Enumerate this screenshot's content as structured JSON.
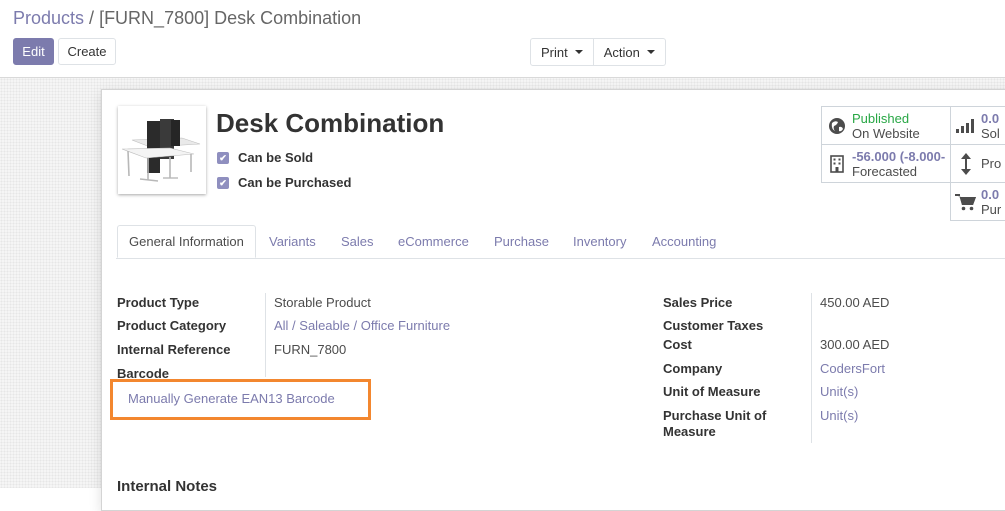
{
  "breadcrumb": {
    "parent": "Products",
    "separator": "/",
    "current": "[FURN_7800] Desk Combination"
  },
  "toolbar": {
    "edit_label": "Edit",
    "create_label": "Create",
    "print_label": "Print",
    "action_label": "Action"
  },
  "product": {
    "name": "Desk Combination",
    "can_be_sold_label": "Can be Sold",
    "can_be_purchased_label": "Can be Purchased",
    "image_icon": "desk-combination-image"
  },
  "smart_buttons": {
    "published": {
      "value": "Published",
      "label": "On Website",
      "icon": "globe-icon",
      "color": "#28a745"
    },
    "forecast": {
      "value": "-56.000 (-8.000-",
      "label": "Forecasted",
      "icon": "building-icon"
    },
    "sold": {
      "value": "0.0",
      "label": "Sol",
      "icon": "signal-icon"
    },
    "product_moves": {
      "label": "Pro",
      "icon": "arrows-v-icon"
    },
    "purchased": {
      "value": "0.0",
      "label": "Pur",
      "icon": "cart-icon"
    }
  },
  "tabs": [
    "General Information",
    "Variants",
    "Sales",
    "eCommerce",
    "Purchase",
    "Inventory",
    "Accounting"
  ],
  "general": {
    "left": {
      "product_type_label": "Product Type",
      "product_type": "Storable Product",
      "category_label": "Product Category",
      "category": "All / Saleable / Office Furniture",
      "internal_ref_label": "Internal Reference",
      "internal_ref": "FURN_7800",
      "barcode_label": "Barcode",
      "generate_barcode": "Manually Generate EAN13 Barcode"
    },
    "right": {
      "sales_price_label": "Sales Price",
      "sales_price": "450.00 AED",
      "customer_taxes_label": "Customer Taxes",
      "cost_label": "Cost",
      "cost": "300.00 AED",
      "company_label": "Company",
      "company": "CodersFort",
      "uom_label": "Unit of Measure",
      "uom": "Unit(s)",
      "purchase_uom_label_1": "Purchase Unit of",
      "purchase_uom_label_2": "Measure",
      "purchase_uom": "Unit(s)"
    }
  },
  "internal_notes_heading": "Internal Notes",
  "colors": {
    "accent": "#7c7bad",
    "highlight_border": "#f3872f",
    "published_green": "#28a745"
  }
}
